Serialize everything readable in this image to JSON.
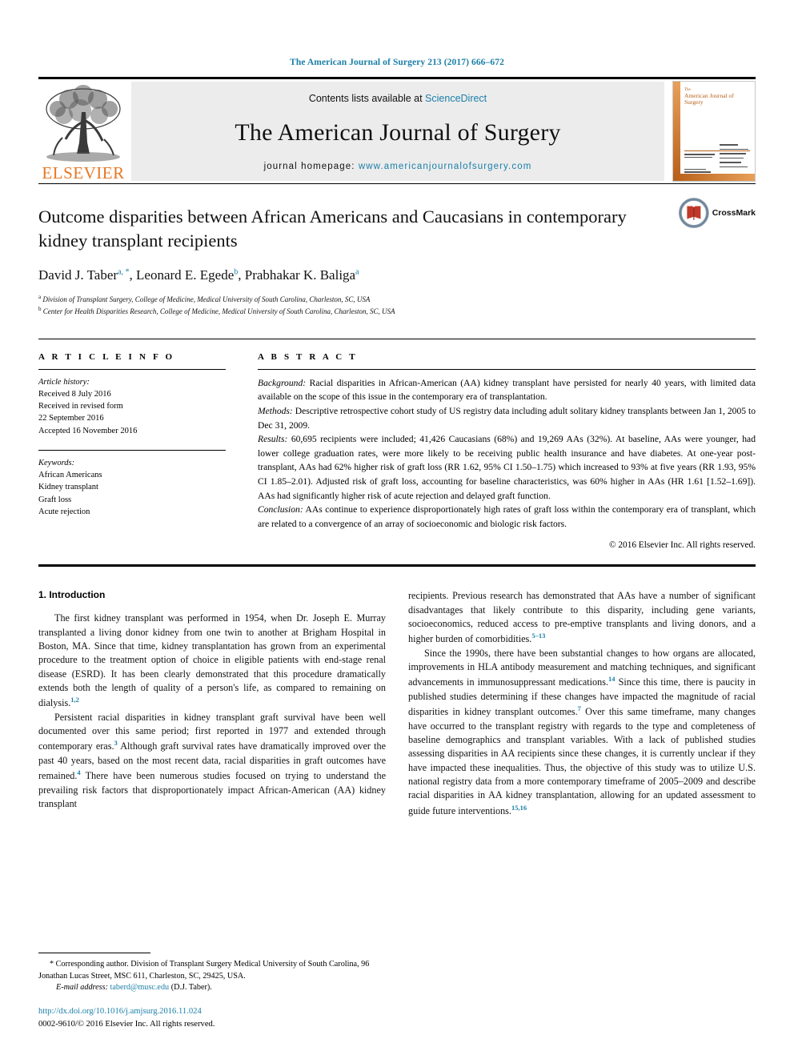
{
  "running_head": "The American Journal of Surgery 213 (2017) 666–672",
  "masthead": {
    "publisher_logo_text": "ELSEVIER",
    "contents_prefix": "Contents lists available at ",
    "contents_link": "ScienceDirect",
    "journal_title": "The American Journal of Surgery",
    "homepage_prefix": "journal homepage: ",
    "homepage_url": "www.americanjournalofsurgery.com",
    "cover_title_small": "The",
    "cover_title_main": "American Journal of Surgery"
  },
  "title": "Outcome disparities between African Americans and Caucasians in contemporary kidney transplant recipients",
  "authors": "David J. Taber, Leonard E. Egede, Prabhakar K. Baliga",
  "author_list": [
    {
      "name": "David J. Taber",
      "marks": "a, *"
    },
    {
      "name": "Leonard E. Egede",
      "marks": "b"
    },
    {
      "name": "Prabhakar K. Baliga",
      "marks": "a"
    }
  ],
  "affiliations": [
    {
      "mark": "a",
      "text": "Division of Transplant Surgery, College of Medicine, Medical University of South Carolina, Charleston, SC, USA"
    },
    {
      "mark": "b",
      "text": "Center for Health Disparities Research, College of Medicine, Medical University of South Carolina, Charleston, SC, USA"
    }
  ],
  "crossmark": {
    "label": "CrossMark"
  },
  "article_info": {
    "heading": "A R T I C L E  I N F O",
    "history_label": "Article history:",
    "history": [
      "Received 8 July 2016",
      "Received in revised form",
      "22 September 2016",
      "Accepted 16 November 2016"
    ],
    "keywords_label": "Keywords:",
    "keywords": [
      "African Americans",
      "Kidney transplant",
      "Graft loss",
      "Acute rejection"
    ]
  },
  "abstract": {
    "heading": "A B S T R A C T",
    "background_label": "Background:",
    "background": " Racial disparities in African-American (AA) kidney transplant have persisted for nearly 40 years, with limited data available on the scope of this issue in the contemporary era of transplantation.",
    "methods_label": "Methods:",
    "methods": " Descriptive retrospective cohort study of US registry data including adult solitary kidney transplants between Jan 1, 2005 to Dec 31, 2009.",
    "results_label": "Results:",
    "results": " 60,695 recipients were included; 41,426 Caucasians (68%) and 19,269 AAs (32%). At baseline, AAs were younger, had lower college graduation rates, were more likely to be receiving public health insurance and have diabetes. At one-year post-transplant, AAs had 62% higher risk of graft loss (RR 1.62, 95% CI 1.50–1.75) which increased to 93% at five years (RR 1.93, 95% CI 1.85–2.01). Adjusted risk of graft loss, accounting for baseline characteristics, was 60% higher in AAs (HR 1.61 [1.52–1.69]). AAs had significantly higher risk of acute rejection and delayed graft function.",
    "conclusion_label": "Conclusion:",
    "conclusion": " AAs continue to experience disproportionately high rates of graft loss within the contemporary era of transplant, which are related to a convergence of an array of socioeconomic and biologic risk factors.",
    "copyright": "© 2016 Elsevier Inc. All rights reserved."
  },
  "body": {
    "section_heading": "1. Introduction",
    "left_paragraphs": [
      {
        "text_1": "The first kidney transplant was performed in 1954, when Dr. Joseph E. Murray transplanted a living donor kidney from one twin to another at Brigham Hospital in Boston, MA. Since that time, kidney transplantation has grown from an experimental procedure to the treatment option of choice in eligible patients with end-stage renal disease (ESRD). It has been clearly demonstrated that this procedure dramatically extends both the length of quality of a person's life, as compared to remaining on dialysis.",
        "sup_1": "1,2",
        "text_2": ""
      },
      {
        "text_1": "Persistent racial disparities in kidney transplant graft survival have been well documented over this same period; first reported in 1977 and extended through contemporary eras.",
        "sup_1": "3",
        "text_2": " Although graft survival rates have dramatically improved over the past 40 years, based on the most recent data, racial disparities in graft outcomes have remained.",
        "sup_2": "4",
        "text_3": " There have been numerous studies focused on trying to understand the prevailing risk factors that disproportionately impact African-American (AA) kidney transplant"
      }
    ],
    "right_paragraphs": [
      {
        "text_1": "recipients. Previous research has demonstrated that AAs have a number of significant disadvantages that likely contribute to this disparity, including gene variants, socioeconomics, reduced access to pre-emptive transplants and living donors, and a higher burden of comorbidities.",
        "sup_1": "5–13"
      },
      {
        "text_1": "Since the 1990s, there have been substantial changes to how organs are allocated, improvements in HLA antibody measurement and matching techniques, and significant advancements in immunosuppressant medications.",
        "sup_1": "14",
        "text_2": " Since this time, there is paucity in published studies determining if these changes have impacted the magnitude of racial disparities in kidney transplant outcomes.",
        "sup_2": "7",
        "text_3": " Over this same timeframe, many changes have occurred to the transplant registry with regards to the type and completeness of baseline demographics and transplant variables. With a lack of published studies assessing disparities in AA recipients since these changes, it is currently unclear if they have impacted these inequalities. Thus, the objective of this study was to utilize U.S. national registry data from a more contemporary timeframe of 2005–2009 and describe racial disparities in AA kidney transplantation, allowing for an updated assessment to guide future interventions.",
        "sup_3": "15,16"
      }
    ]
  },
  "footnote": {
    "corresponding_marker": "*",
    "corresponding": " Corresponding author. Division of Transplant Surgery Medical University of South Carolina, 96 Jonathan Lucas Street, MSC 611, Charleston, SC, 29425, USA.",
    "email_label": "E-mail address:",
    "email": "taberd@musc.edu",
    "email_suffix": " (D.J. Taber).",
    "doi": "http://dx.doi.org/10.1016/j.amjsurg.2016.11.024",
    "issn": "0002-9610/© 2016 Elsevier Inc. All rights reserved."
  },
  "colors": {
    "link": "#1a7fa8",
    "elsevier_orange": "#E87722",
    "masthead_gray": "#ececec"
  }
}
